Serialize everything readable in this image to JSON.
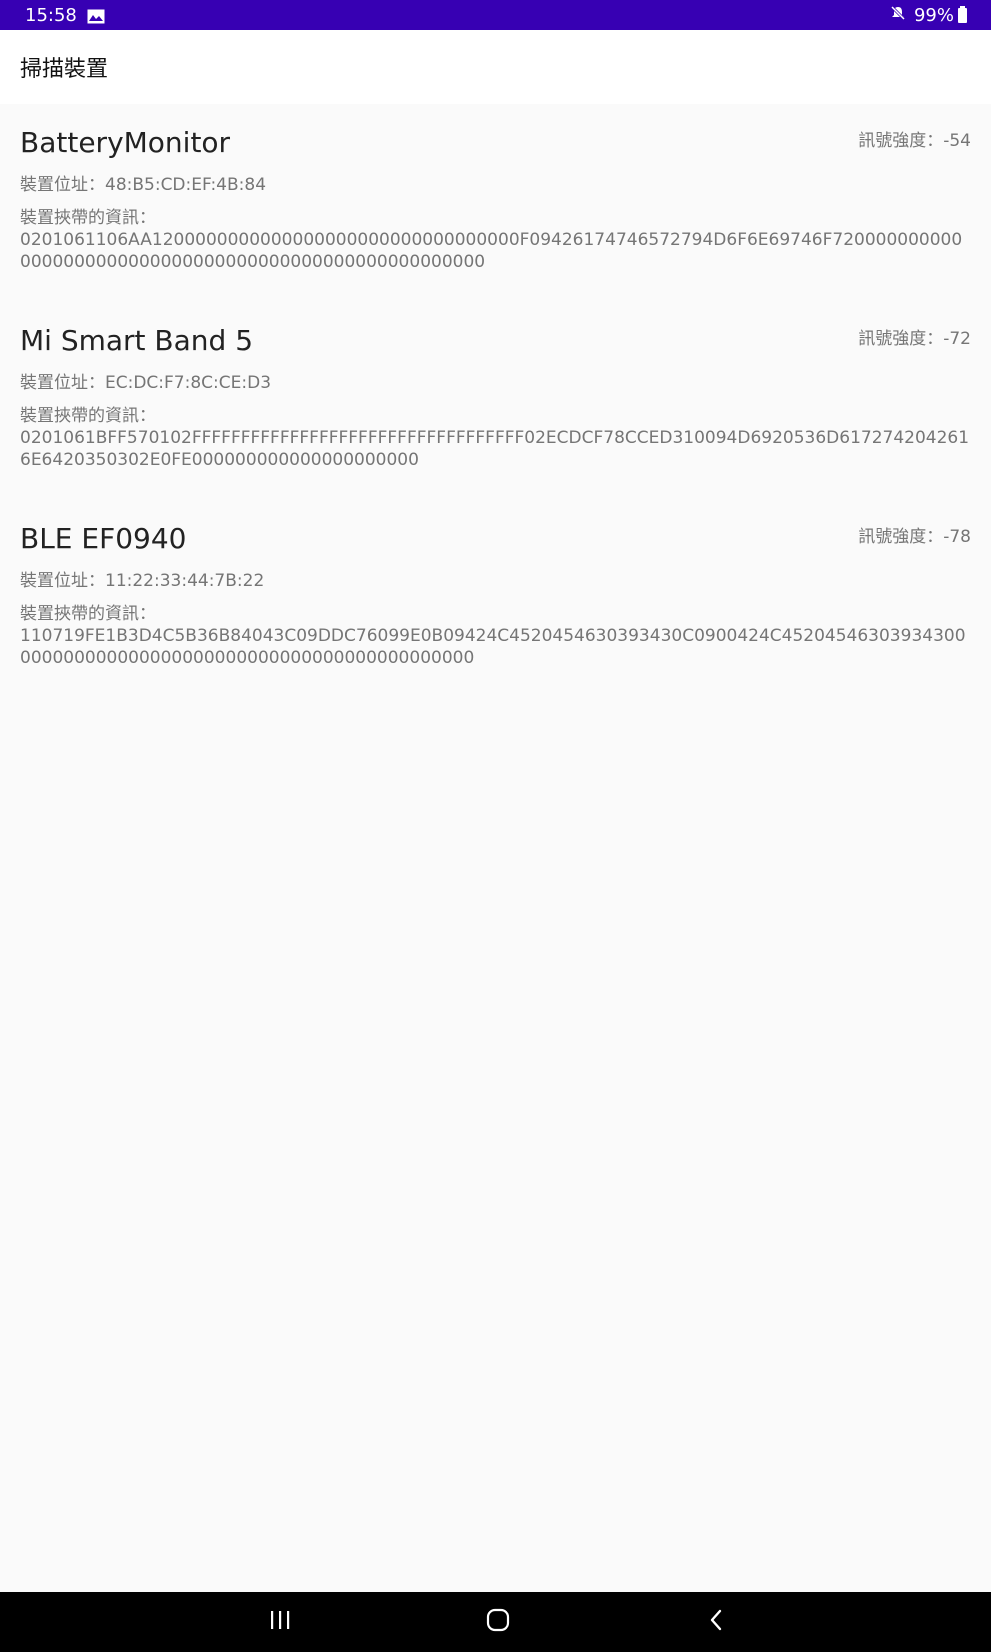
{
  "status_bar": {
    "time": "15:58",
    "battery": "99%",
    "icons": [
      "gallery-icon",
      "mute-icon",
      "battery-icon"
    ]
  },
  "app_bar": {
    "title": "掃描裝置"
  },
  "devices": [
    {
      "name": "BatteryMonitor",
      "rssi": "訊號強度：-54",
      "address": "裝置位址：48:B5:CD:EF:4B:84",
      "adv_label": "裝置挾帶的資訊：",
      "adv_data": "0201061106AA1200000000000000000000000000000000F09426174746572794D6F6E69746F7200000000000000000000000000000000000000000000000000000"
    },
    {
      "name": "Mi Smart Band 5",
      "rssi": "訊號強度：-72",
      "address": "裝置位址：EC:DC:F7:8C:CE:D3",
      "adv_label": "裝置挾帶的資訊：",
      "adv_data": "0201061BFF570102FFFFFFFFFFFFFFFFFFFFFFFFFFFFFFFFFF02ECDCF78CCED310094D6920536D6172742042616E6420350302E0FE000000000000000000000"
    },
    {
      "name": "BLE EF0940",
      "rssi": "訊號強度：-78",
      "address": "裝置位址：11:22:33:44:7B:22",
      "adv_label": "裝置挾帶的資訊：",
      "adv_data": "110719FE1B3D4C5B36B84043C09DDC76099E0B09424C4520454630393430C0900424C45204546303934300000000000000000000000000000000000000000000"
    }
  ],
  "nav_bar": {
    "icons": [
      "recent-apps-icon",
      "home-icon",
      "back-icon"
    ]
  },
  "colors": {
    "status_bar": "#3700b3",
    "background": "#fafafa",
    "secondary_text": "#757575"
  }
}
